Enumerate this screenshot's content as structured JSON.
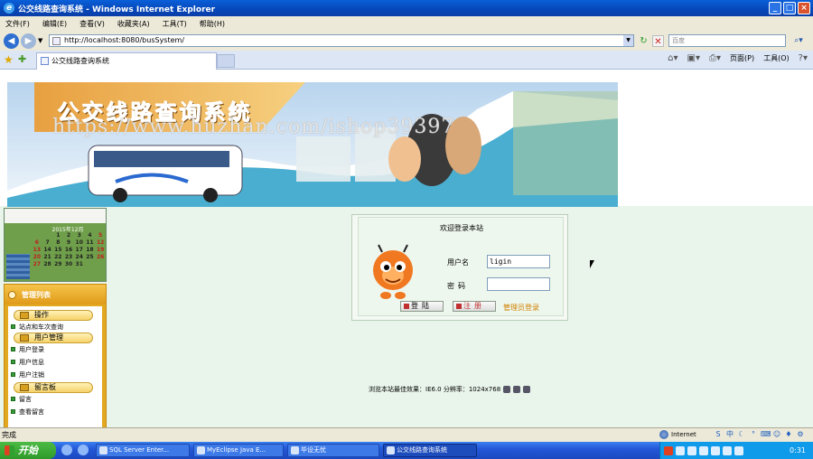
{
  "window": {
    "title": "公交线路查询系统 - Windows Internet Explorer",
    "controls": [
      "_",
      "□",
      "×"
    ]
  },
  "menu": [
    "文件(F)",
    "编辑(E)",
    "查看(V)",
    "收藏夹(A)",
    "工具(T)",
    "帮助(H)"
  ],
  "address": {
    "url": "http://localhost:8080/busSystem/",
    "search_placeholder": "百度"
  },
  "tab": {
    "label": "公交线路查询系统"
  },
  "command_bar": {
    "page": "页面(P)",
    "tools": "工具(O)"
  },
  "banner": {
    "title": "公交线路查询系统",
    "watermark": "https://www.huzhan.com/ishop39397"
  },
  "calendar": {
    "month": "2015年12月",
    "days": [
      "",
      "",
      "1",
      "2",
      "3",
      "4",
      "5",
      "6",
      "7",
      "8",
      "9",
      "10",
      "11",
      "12",
      "13",
      "14",
      "15",
      "16",
      "17",
      "18",
      "19",
      "20",
      "21",
      "22",
      "23",
      "24",
      "25",
      "26",
      "27",
      "28",
      "29",
      "30",
      "31",
      "",
      ""
    ]
  },
  "sidebar": {
    "title": "管理列表",
    "categories": [
      {
        "label": "操作",
        "items": [
          "站点和车次查询"
        ]
      },
      {
        "label": "用户管理",
        "items": [
          "用户登录",
          "用户信息",
          "用户注销"
        ]
      },
      {
        "label": "留言板",
        "items": [
          "留言",
          "查看留言"
        ]
      }
    ]
  },
  "login": {
    "title": "欢迎登录本站",
    "username_label": "用户名",
    "password_label": "密码",
    "username_value": "ligin",
    "login_button": "登陆",
    "register_button": "注册",
    "admin_link": "管理员登录"
  },
  "footer_note": "浏览本站最佳效果：IE6.0 分辨率：1024x768",
  "status": {
    "text": "完成",
    "zone": "Internet"
  },
  "taskbar": {
    "start": "开始",
    "tasks": [
      "SQL Server Enter...",
      "MyEclipse Java E...",
      "毕设无忧",
      "公交线路查询系统"
    ],
    "clock": "0:31"
  },
  "colors": {
    "titlebar": "#0a5fd8",
    "content_bg": "#e9f5ea",
    "sidebar": "#e2a820",
    "taskbar": "#2458d8"
  }
}
